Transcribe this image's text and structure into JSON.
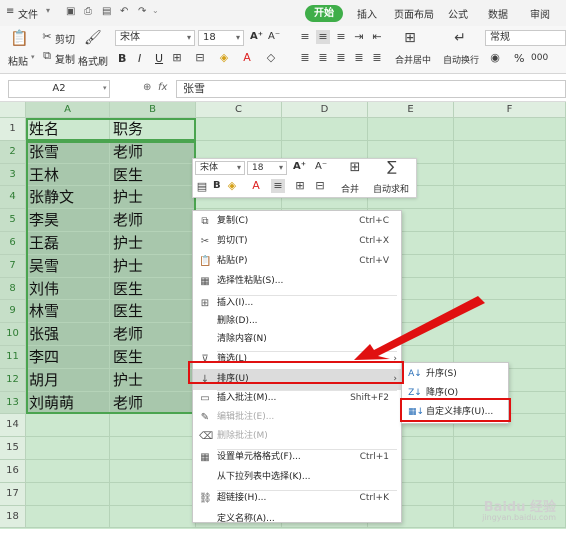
{
  "menubar": {
    "menu_icon": "≡",
    "file": "文件",
    "tabs": [
      "开始",
      "插入",
      "页面布局",
      "公式",
      "数据",
      "审阅"
    ]
  },
  "toolbar": {
    "paste": "粘贴",
    "cut": "剪切",
    "copy": "复制",
    "format_painter": "格式刷",
    "font_name": "宋体",
    "font_size": "18",
    "merge_center": "合并居中",
    "wrap_text": "自动换行",
    "number_format": "常规",
    "bold": "B",
    "italic": "I",
    "underline": "U",
    "font_grow": "A⁺",
    "font_shrink": "A⁻",
    "percent": "%",
    "thousands": "000"
  },
  "formula_bar": {
    "name_box": "A2",
    "fx": "fx",
    "content": "张雪"
  },
  "columns": [
    "A",
    "B",
    "C",
    "D",
    "E",
    "F"
  ],
  "rows": [
    "1",
    "2",
    "3",
    "4",
    "5",
    "6",
    "7",
    "8",
    "9",
    "10",
    "11",
    "12",
    "13",
    "14",
    "15",
    "16",
    "17",
    "18"
  ],
  "table": {
    "header": [
      "姓名",
      "职务"
    ],
    "data": [
      [
        "张雪",
        "老师"
      ],
      [
        "王林",
        "医生"
      ],
      [
        "张静文",
        "护士"
      ],
      [
        "李昊",
        "老师"
      ],
      [
        "王磊",
        "护士"
      ],
      [
        "吴雪",
        "护士"
      ],
      [
        "刘伟",
        "医生"
      ],
      [
        "林雪",
        "医生"
      ],
      [
        "张强",
        "老师"
      ],
      [
        "李四",
        "医生"
      ],
      [
        "胡月",
        "护士"
      ],
      [
        "刘萌萌",
        "老师"
      ]
    ]
  },
  "mini_toolbar": {
    "font_name": "宋体",
    "font_size": "18",
    "bold": "B",
    "merge": "合并",
    "autosum": "自动求和"
  },
  "context_menu": [
    {
      "label": "复制(C)",
      "shortcut": "Ctrl+C",
      "icon": "copy-icon"
    },
    {
      "label": "剪切(T)",
      "shortcut": "Ctrl+X",
      "icon": "scissors-icon"
    },
    {
      "label": "粘贴(P)",
      "shortcut": "Ctrl+V",
      "icon": "paste-icon"
    },
    {
      "label": "选择性粘贴(S)...",
      "shortcut": "",
      "icon": "paste-special-icon"
    },
    {
      "label": "插入(I)...",
      "shortcut": "",
      "icon": "insert-icon"
    },
    {
      "label": "删除(D)...",
      "shortcut": "",
      "icon": ""
    },
    {
      "label": "清除内容(N)",
      "shortcut": "",
      "icon": ""
    },
    {
      "label": "筛选(L)",
      "shortcut": "",
      "icon": "filter-icon"
    },
    {
      "label": "排序(U)",
      "shortcut": "",
      "icon": "sort-icon"
    },
    {
      "label": "插入批注(M)...",
      "shortcut": "Shift+F2",
      "icon": "comment-icon"
    },
    {
      "label": "编辑批注(E)...",
      "shortcut": "",
      "icon": "edit-comment-icon"
    },
    {
      "label": "删除批注(M)",
      "shortcut": "",
      "icon": "delete-comment-icon"
    },
    {
      "label": "设置单元格格式(F)...",
      "shortcut": "Ctrl+1",
      "icon": "format-cells-icon"
    },
    {
      "label": "从下拉列表中选择(K)...",
      "shortcut": "",
      "icon": ""
    },
    {
      "label": "超链接(H)...",
      "shortcut": "Ctrl+K",
      "icon": "link-icon"
    },
    {
      "label": "定义名称(A)...",
      "shortcut": "",
      "icon": ""
    }
  ],
  "sort_submenu": [
    {
      "label": "升序(S)",
      "icon": "sort-ascending-icon"
    },
    {
      "label": "降序(O)",
      "icon": "sort-descending-icon"
    },
    {
      "label": "自定义排序(U)...",
      "icon": "custom-sort-icon"
    }
  ],
  "watermark": {
    "brand": "Baidu 经验",
    "url": "jingyan.baidu.com"
  },
  "colors": {
    "accent_green": "#3fae49",
    "sheet_bg": "#cce8cf",
    "highlight_red": "#e01010"
  }
}
